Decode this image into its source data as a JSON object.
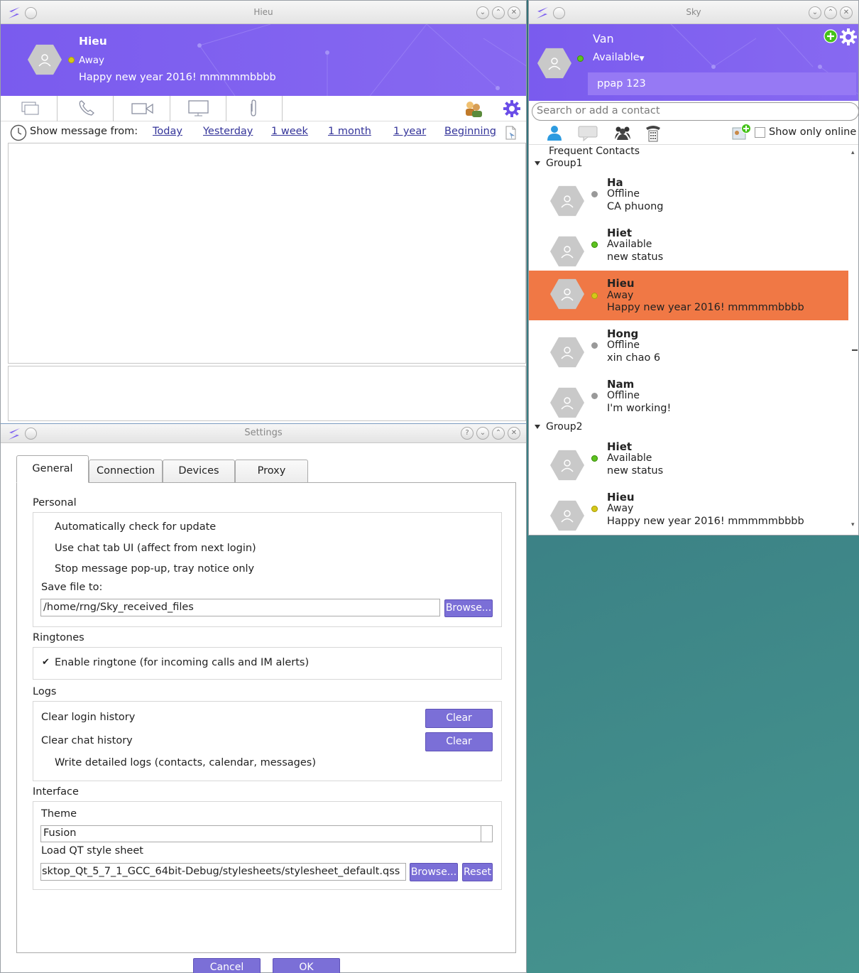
{
  "chat_window": {
    "title": "Hieu",
    "name": "Hieu",
    "status": "Away",
    "mood": "Happy new year 2016! mmmmmbbbb",
    "show_from_label": "Show message from:",
    "filters": [
      "Today",
      "Yesterday",
      "1 week",
      "1 month",
      "1 year",
      "Beginning"
    ]
  },
  "settings": {
    "title": "Settings",
    "tabs": [
      "General",
      "Connection",
      "Devices",
      "Proxy"
    ],
    "personal": {
      "header": "Personal",
      "opt1": "Automatically check for update",
      "opt2": "Use chat tab UI (affect from next login)",
      "opt3": "Stop message pop-up, tray notice only",
      "save_label": "Save file to:",
      "save_path": "/home/rng/Sky_received_files",
      "browse": "Browse..."
    },
    "ringtones": {
      "header": "Ringtones",
      "check": "✔",
      "opt": "Enable ringtone (for incoming calls and IM alerts)"
    },
    "logs": {
      "header": "Logs",
      "login": "Clear login history",
      "chat": "Clear chat history",
      "clear": "Clear",
      "detailed": "Write detailed logs (contacts, calendar, messages)"
    },
    "interface": {
      "header": "Interface",
      "theme_label": "Theme",
      "theme_value": "Fusion",
      "qss_label": "Load QT style sheet",
      "qss_path": "sktop_Qt_5_7_1_GCC_64bit-Debug/stylesheets/stylesheet_default.qss",
      "browse": "Browse...",
      "reset": "Reset"
    },
    "cancel": "Cancel",
    "ok": "OK"
  },
  "sky": {
    "title": "Sky",
    "user": "Van",
    "status": "Available",
    "mood": "ppap 123",
    "search_placeholder": "Search or add a contact",
    "show_online": "Show only online",
    "frequent": "Frequent Contacts",
    "group1": "Group1",
    "group2": "Group2",
    "contacts1": [
      {
        "name": "Ha",
        "status": "Offline",
        "msg": "CA phuong"
      },
      {
        "name": "Hiet",
        "status": "Available",
        "msg": "new status"
      },
      {
        "name": "Hieu",
        "status": "Away",
        "msg": "Happy new year 2016! mmmmmbbbb"
      },
      {
        "name": "Hong",
        "status": "Offline",
        "msg": "xin chao 6"
      },
      {
        "name": "Nam",
        "status": "Offline",
        "msg": "I'm working!"
      }
    ],
    "contacts2": [
      {
        "name": "Hiet",
        "status": "Available",
        "msg": "new status"
      },
      {
        "name": "Hieu",
        "status": "Away",
        "msg": "Happy new year 2016! mmmmmbbbb"
      }
    ],
    "selected_color": "#f07845"
  },
  "colors": {
    "accent": "#7b5df0",
    "button": "#7b6fd7",
    "gear": "#6a4de8"
  }
}
